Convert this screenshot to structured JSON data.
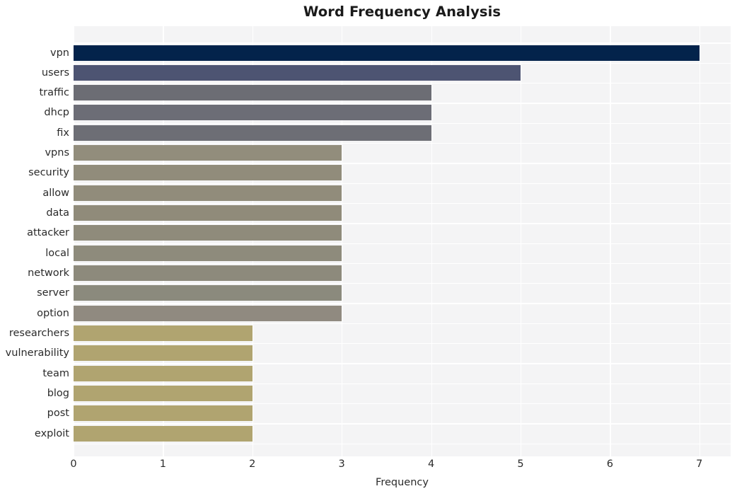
{
  "chart_data": {
    "type": "bar",
    "orientation": "horizontal",
    "title": "Word Frequency Analysis",
    "xlabel": "Frequency",
    "ylabel": "",
    "xlim": [
      0,
      7.35
    ],
    "xticks": [
      0,
      1,
      2,
      3,
      4,
      5,
      6,
      7
    ],
    "xtick_labels": [
      "0",
      "1",
      "2",
      "3",
      "4",
      "5",
      "6",
      "7"
    ],
    "grid": true,
    "legend": null,
    "categories": [
      "vpn",
      "users",
      "traffic",
      "dhcp",
      "fix",
      "vpns",
      "security",
      "allow",
      "data",
      "attacker",
      "local",
      "network",
      "server",
      "option",
      "researchers",
      "vulnerability",
      "team",
      "blog",
      "post",
      "exploit"
    ],
    "values": [
      7,
      5,
      4,
      4,
      4,
      3,
      3,
      3,
      3,
      3,
      3,
      3,
      3,
      3,
      2,
      2,
      2,
      2,
      2,
      2
    ],
    "bar_colors": [
      "#03234b",
      "#4d5472",
      "#6c6d74",
      "#6c6d76",
      "#6d6e75",
      "#928d7c",
      "#918c7b",
      "#918c7b",
      "#908b7a",
      "#8f8b7b",
      "#8e8b7c",
      "#8d8a7c",
      "#8b8a7d",
      "#908a80",
      "#b0a470",
      "#b0a470",
      "#b0a470",
      "#b0a470",
      "#b0a470",
      "#b0a470"
    ],
    "plot_background": "#f4f4f5",
    "gridline_color": "#ffffff",
    "figure_background": "#ffffff",
    "text_color": "#2b2b2b"
  }
}
